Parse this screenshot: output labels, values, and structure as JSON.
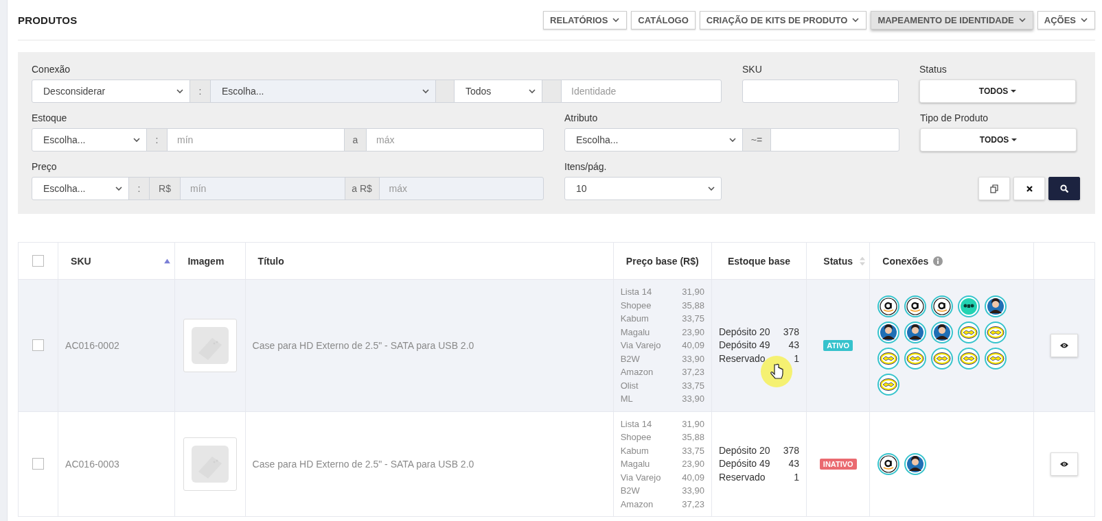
{
  "page_title": "PRODUTOS",
  "toolbar": [
    {
      "label": "RELATÓRIOS",
      "dropdown": true,
      "active": false
    },
    {
      "label": "CATÁLOGO",
      "dropdown": false,
      "active": false
    },
    {
      "label": "CRIAÇÃO DE KITS DE PRODUTO",
      "dropdown": true,
      "active": false
    },
    {
      "label": "MAPEAMENTO DE IDENTIDADE",
      "dropdown": true,
      "active": true
    },
    {
      "label": "AÇÕES",
      "dropdown": true,
      "active": false
    }
  ],
  "filters": {
    "rows": [
      [
        {
          "label": "Conexão",
          "parts": [
            {
              "kind": "select",
              "value": "Desconsiderar",
              "disabled": false
            },
            {
              "kind": "addon",
              "text": ":"
            },
            {
              "kind": "select",
              "value": "Escolha...",
              "disabled": true
            },
            {
              "kind": "addon"
            },
            {
              "kind": "select",
              "value": "Todos",
              "disabled": false
            },
            {
              "kind": "addon"
            },
            {
              "kind": "input",
              "placeholder": "Identidade",
              "disabled": false
            }
          ]
        },
        {
          "label": "SKU",
          "parts": [
            {
              "kind": "input",
              "disabled": false
            }
          ]
        },
        {
          "label": "Status",
          "parts": [
            {
              "kind": "dropdown",
              "value": "TODOS"
            }
          ]
        }
      ],
      [
        {
          "label": "Estoque",
          "parts": [
            {
              "kind": "select",
              "value": "Escolha...",
              "disabled": false
            },
            {
              "kind": "addon",
              "text": ":"
            },
            {
              "kind": "input",
              "placeholder": "mín",
              "disabled": false
            },
            {
              "kind": "addon",
              "text": "a"
            },
            {
              "kind": "input",
              "placeholder": "máx",
              "disabled": false
            }
          ]
        },
        {
          "label": "Atributo",
          "parts": [
            {
              "kind": "select",
              "value": "Escolha...",
              "disabled": false
            },
            {
              "kind": "addon",
              "text": "~="
            },
            {
              "kind": "input",
              "disabled": false
            }
          ]
        },
        {
          "label": "Tipo de Produto",
          "parts": [
            {
              "kind": "dropdown",
              "value": "TODOS"
            }
          ]
        }
      ],
      [
        {
          "label": "Preço",
          "parts": [
            {
              "kind": "select",
              "value": "Escolha...",
              "disabled": false
            },
            {
              "kind": "addon",
              "text": ":"
            },
            {
              "kind": "addon",
              "text": "R$"
            },
            {
              "kind": "input",
              "placeholder": "mín",
              "disabled": true
            },
            {
              "kind": "addon",
              "text": "a R$"
            },
            {
              "kind": "input",
              "placeholder": "máx",
              "disabled": true
            }
          ]
        },
        {
          "label": "Itens/pág.",
          "parts": [
            {
              "kind": "select",
              "value": "10",
              "disabled": false
            }
          ]
        }
      ]
    ],
    "actions": [
      {
        "kind": "copy"
      },
      {
        "kind": "clear"
      },
      {
        "kind": "search"
      }
    ]
  },
  "table": {
    "select_all": {
      "checked": false
    },
    "columns": [
      {
        "label": "SKU",
        "sortable": true,
        "sorted": true
      },
      {
        "label": "Imagem"
      },
      {
        "label": "Título"
      },
      {
        "label": "Preço base (R$)"
      },
      {
        "label": "Estoque base"
      },
      {
        "label": "Status",
        "sortable": true,
        "sorted": false
      },
      {
        "label": "Conexões",
        "info": true
      }
    ],
    "rows": [
      {
        "checked": false,
        "highlighted": true,
        "sku": "AC016-0002",
        "title": "Case para HD Externo de 2.5\" - SATA para USB 2.0",
        "prices": [
          {
            "store": "Lista 14",
            "value": "31,90"
          },
          {
            "store": "Shopee",
            "value": "35,88"
          },
          {
            "store": "Kabum",
            "value": "33,75"
          },
          {
            "store": "Magalu",
            "value": "23,90"
          },
          {
            "store": "Via Varejo",
            "value": "40,09"
          },
          {
            "store": "B2W",
            "value": "33,90"
          },
          {
            "store": "Amazon",
            "value": "37,23"
          },
          {
            "store": "Olist",
            "value": "33,75"
          },
          {
            "store": "ML",
            "value": "33,90"
          }
        ],
        "stock": [
          {
            "label": "Depósito 20",
            "value": "378"
          },
          {
            "label": "Depósito 49",
            "value": "43"
          },
          {
            "label": "Reservado",
            "value": "1"
          }
        ],
        "status": {
          "label": "ATIVO",
          "kind": "active"
        },
        "connections": [
          {
            "kind": "amazon"
          },
          {
            "kind": "amazon"
          },
          {
            "kind": "amazon"
          },
          {
            "kind": "b2w"
          },
          {
            "kind": "avatar"
          },
          {
            "kind": "avatar"
          },
          {
            "kind": "avatar"
          },
          {
            "kind": "avatar"
          },
          {
            "kind": "handshake"
          },
          {
            "kind": "handshake"
          },
          {
            "kind": "handshake"
          },
          {
            "kind": "handshake"
          },
          {
            "kind": "handshake"
          },
          {
            "kind": "handshake"
          },
          {
            "kind": "handshake"
          },
          {
            "kind": "handshake"
          }
        ]
      },
      {
        "checked": false,
        "highlighted": false,
        "sku": "AC016-0003",
        "title": "Case para HD Externo de 2.5\" - SATA para USB 2.0",
        "prices": [
          {
            "store": "Lista 14",
            "value": "31,90"
          },
          {
            "store": "Shopee",
            "value": "35,88"
          },
          {
            "store": "Kabum",
            "value": "33,75"
          },
          {
            "store": "Magalu",
            "value": "23,90"
          },
          {
            "store": "Via Varejo",
            "value": "40,09"
          },
          {
            "store": "B2W",
            "value": "33,90"
          },
          {
            "store": "Amazon",
            "value": "37,23"
          }
        ],
        "stock": [
          {
            "label": "Depósito 20",
            "value": "378"
          },
          {
            "label": "Depósito 49",
            "value": "43"
          },
          {
            "label": "Reservado",
            "value": "1"
          }
        ],
        "status": {
          "label": "INATIVO",
          "kind": "inactive"
        },
        "connections": [
          {
            "kind": "amazon"
          },
          {
            "kind": "avatar"
          }
        ]
      }
    ]
  }
}
